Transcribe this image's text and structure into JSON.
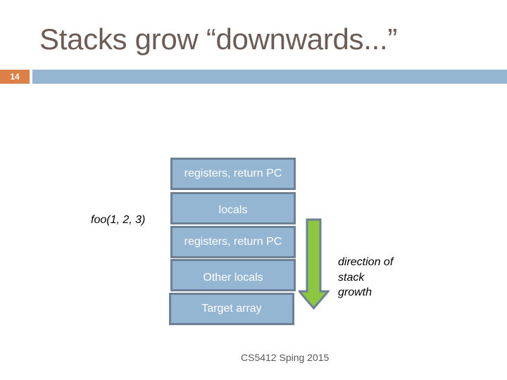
{
  "slide": {
    "title": "Stacks grow “downwards...”",
    "number": "14",
    "footer": "CS5412 Sping 2015"
  },
  "diagram": {
    "call_label": "foo(1, 2, 3)",
    "stack_frames": [
      {
        "label": "registers, return PC"
      },
      {
        "label": "locals"
      },
      {
        "label": "registers, return PC"
      },
      {
        "label": "Other locals"
      },
      {
        "label": "Target array"
      }
    ],
    "growth_arrow": {
      "direction": "down",
      "label_lines": [
        "direction of",
        "stack",
        "growth"
      ],
      "fill_color": "#8dc63f",
      "stroke_color": "#6c8196"
    },
    "box_fill_color": "#94b6d2",
    "box_border_color": "#6c8196"
  },
  "colors": {
    "title": "#6b5d55",
    "slide_number_bg": "#dd8047",
    "header_bar": "#94b6d2"
  }
}
